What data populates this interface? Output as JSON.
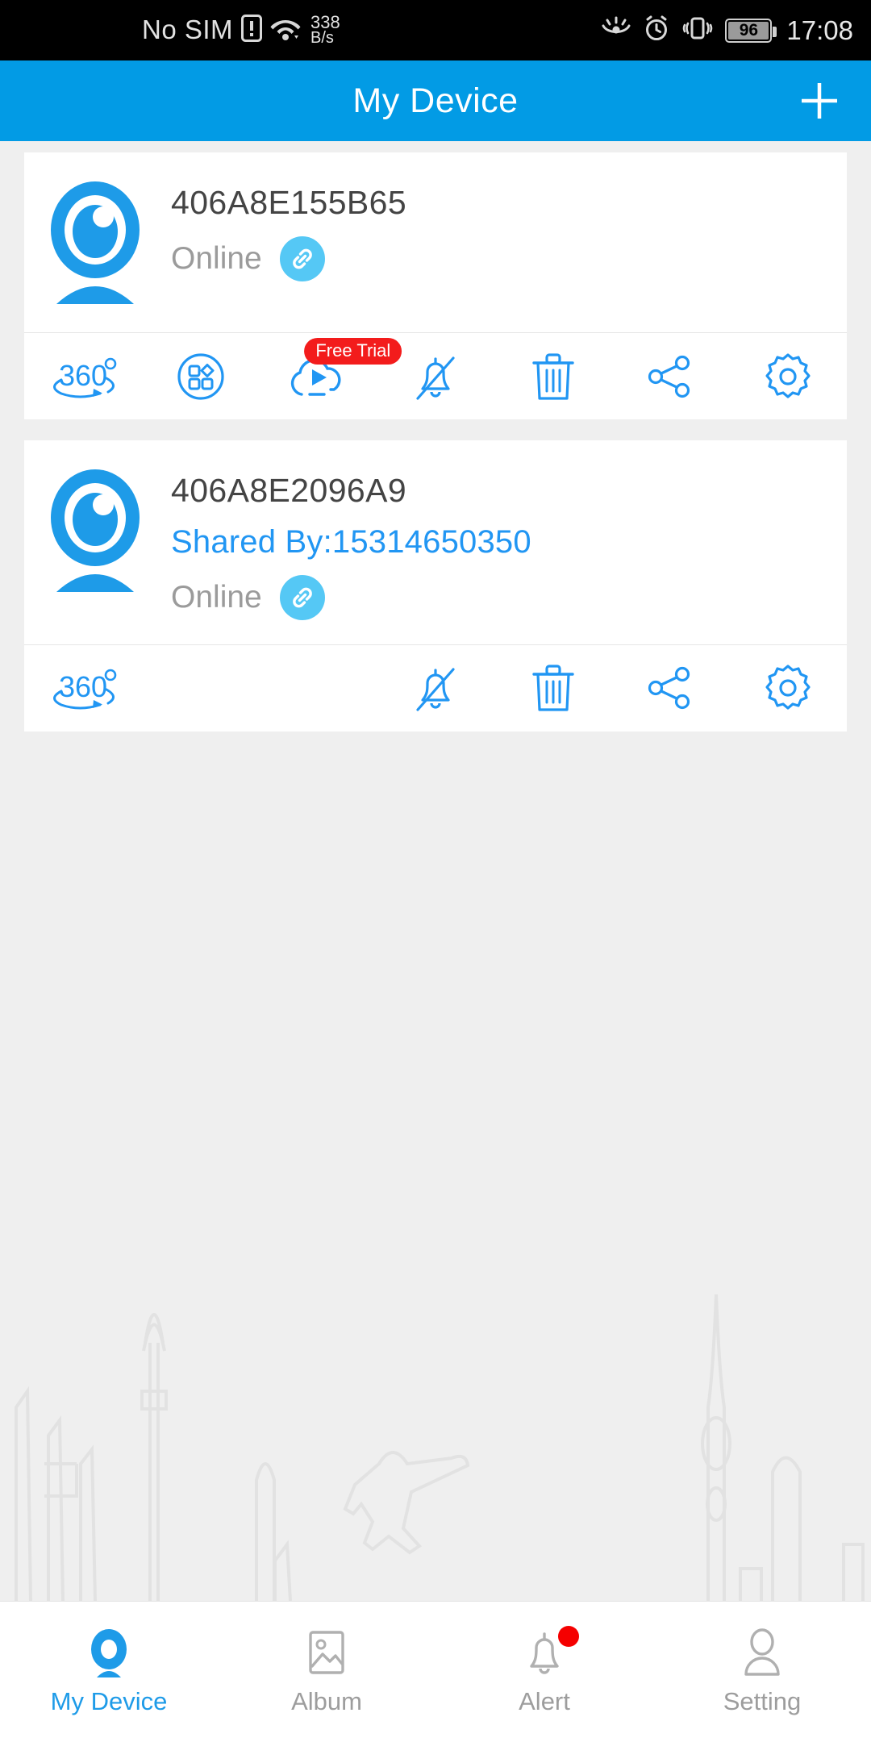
{
  "statusbar": {
    "carrier": "No SIM",
    "netspeed_value": "338",
    "netspeed_unit": "B/s",
    "battery_level": "96",
    "time": "17:08",
    "icons": [
      "sim-card-alert-icon",
      "wifi-icon",
      "eye-comfort-icon",
      "alarm-clock-icon",
      "vibrate-icon",
      "battery-icon"
    ]
  },
  "header": {
    "title": "My Device",
    "add_icon": "plus-icon",
    "background_color": "#029BE5"
  },
  "devices": [
    {
      "name": "406A8E155B65",
      "shared_by": null,
      "status": "Online",
      "link_icon": "link-chain-icon",
      "device_icon": "camera-eye-icon",
      "actions": [
        {
          "icon": "360-rotate-icon",
          "label": "360°",
          "badge": null
        },
        {
          "icon": "grid-apps-icon",
          "label": "Functions",
          "badge": null
        },
        {
          "icon": "cloud-play-icon",
          "label": "Cloud",
          "badge": "Free Trial"
        },
        {
          "icon": "bell-muted-icon",
          "label": "Alert Off",
          "badge": null
        },
        {
          "icon": "trash-icon",
          "label": "Delete",
          "badge": null
        },
        {
          "icon": "share-icon",
          "label": "Share",
          "badge": null
        },
        {
          "icon": "gear-icon",
          "label": "Settings",
          "badge": null
        }
      ]
    },
    {
      "name": "406A8E2096A9",
      "shared_by": "Shared By:15314650350",
      "status": "Online",
      "link_icon": "link-chain-icon",
      "device_icon": "camera-eye-icon",
      "actions": [
        {
          "icon": "360-rotate-icon",
          "label": "360°",
          "badge": null
        },
        {
          "icon": "bell-muted-icon",
          "label": "Alert Off",
          "badge": null
        },
        {
          "icon": "trash-icon",
          "label": "Delete",
          "badge": null
        },
        {
          "icon": "share-icon",
          "label": "Share",
          "badge": null
        },
        {
          "icon": "gear-icon",
          "label": "Settings",
          "badge": null
        }
      ]
    }
  ],
  "tabbar": {
    "items": [
      {
        "label": "My Device",
        "icon": "camera-eye-icon",
        "active": true,
        "badge": false
      },
      {
        "label": "Album",
        "icon": "image-icon",
        "active": false,
        "badge": false
      },
      {
        "label": "Alert",
        "icon": "bell-icon",
        "active": false,
        "badge": true
      },
      {
        "label": "Setting",
        "icon": "person-icon",
        "active": false,
        "badge": false
      }
    ]
  },
  "colors": {
    "accent": "#029BE5",
    "icon_blue": "#2196F3",
    "badge_red": "#F31C1C",
    "muted_text": "#9b9b9b",
    "page_bg": "#EFEFEF"
  }
}
